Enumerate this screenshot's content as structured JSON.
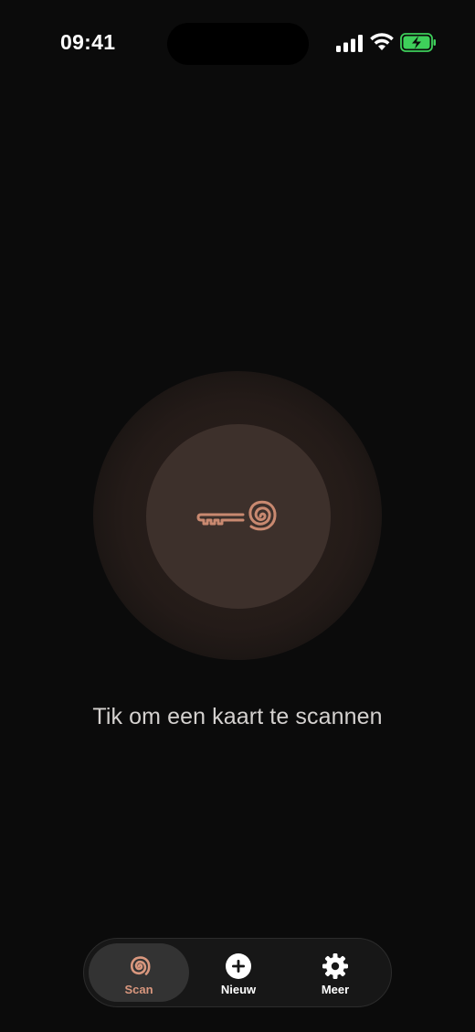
{
  "status_bar": {
    "time": "09:41"
  },
  "colors": {
    "accent": "#d9977e",
    "background": "#0b0b0b",
    "scan_button": "#3d302b",
    "battery_green": "#3ecf5a"
  },
  "main": {
    "scan_icon": "key-spiral-icon",
    "hint": "Tik om een kaart te scannen"
  },
  "tab_bar": {
    "tabs": [
      {
        "label": "Scan",
        "icon": "spiral-icon",
        "active": true
      },
      {
        "label": "Nieuw",
        "icon": "plus-circle-icon",
        "active": false
      },
      {
        "label": "Meer",
        "icon": "gear-icon",
        "active": false
      }
    ]
  }
}
